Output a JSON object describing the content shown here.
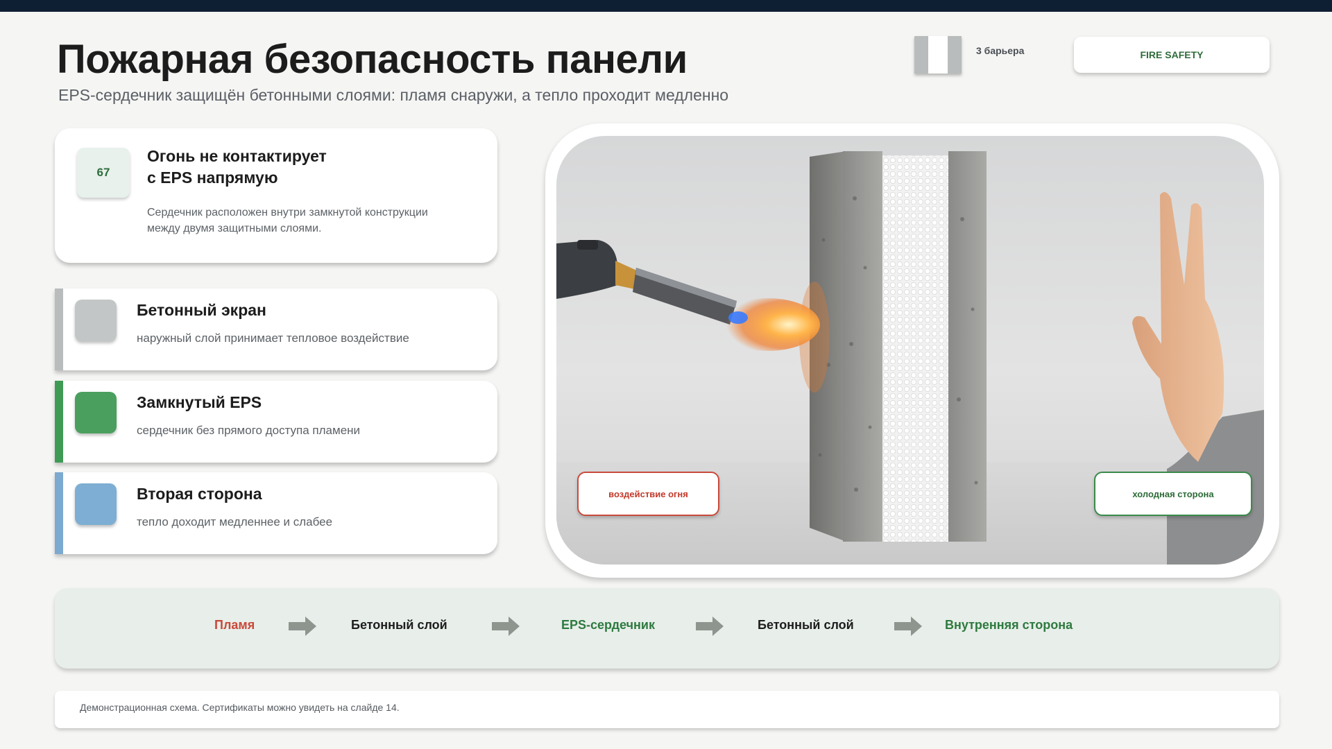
{
  "header": {
    "title": "Пожарная безопасность панели",
    "subtitle": "EPS-сердечник защищён бетонными слоями: пламя снаружи, а тепло проходит медленно",
    "barrier_count": "3 барьера",
    "badge": "FIRE SAFETY"
  },
  "main_card": {
    "number": "67",
    "heading_line1": "Огонь не контактирует",
    "heading_line2": "с EPS напрямую",
    "description_line1": "Сердечник расположен внутри замкнутой конструкции",
    "description_line2": "между двумя защитными слоями."
  },
  "layers": [
    {
      "title": "Бетонный экран",
      "description": "наружный слой принимает тепловое воздействие",
      "stripe_color": "#b9bcbc",
      "swatch_color": "#c2c6c6"
    },
    {
      "title": "Замкнутый EPS",
      "description": "сердечник без прямого доступа пламени",
      "stripe_color": "#3e9a55",
      "swatch_color": "#4a9f5e"
    },
    {
      "title": "Вторая сторона",
      "description": "тепло доходит медленнее и слабее",
      "stripe_color": "#7ba9cf",
      "swatch_color": "#7eaed3"
    }
  ],
  "photo_labels": {
    "fire": "воздействие огня",
    "cold": "холодная сторона"
  },
  "flow": [
    {
      "label": "Пламя",
      "color": "#c9483a"
    },
    {
      "label": "Бетонный слой",
      "color": "#1c1c1c"
    },
    {
      "label": "EPS-сердечник",
      "color": "#2e7a3f"
    },
    {
      "label": "Бетонный слой",
      "color": "#1c1c1c"
    },
    {
      "label": "Внутренняя сторона",
      "color": "#2e7a3f"
    }
  ],
  "footer": {
    "note": "Демонстрационная схема. Сертификаты можно увидеть на слайде 14."
  },
  "colors": {
    "accent_green": "#2e6c3b",
    "fire_red": "#c94a3a",
    "topbar": "#0f1f33"
  }
}
